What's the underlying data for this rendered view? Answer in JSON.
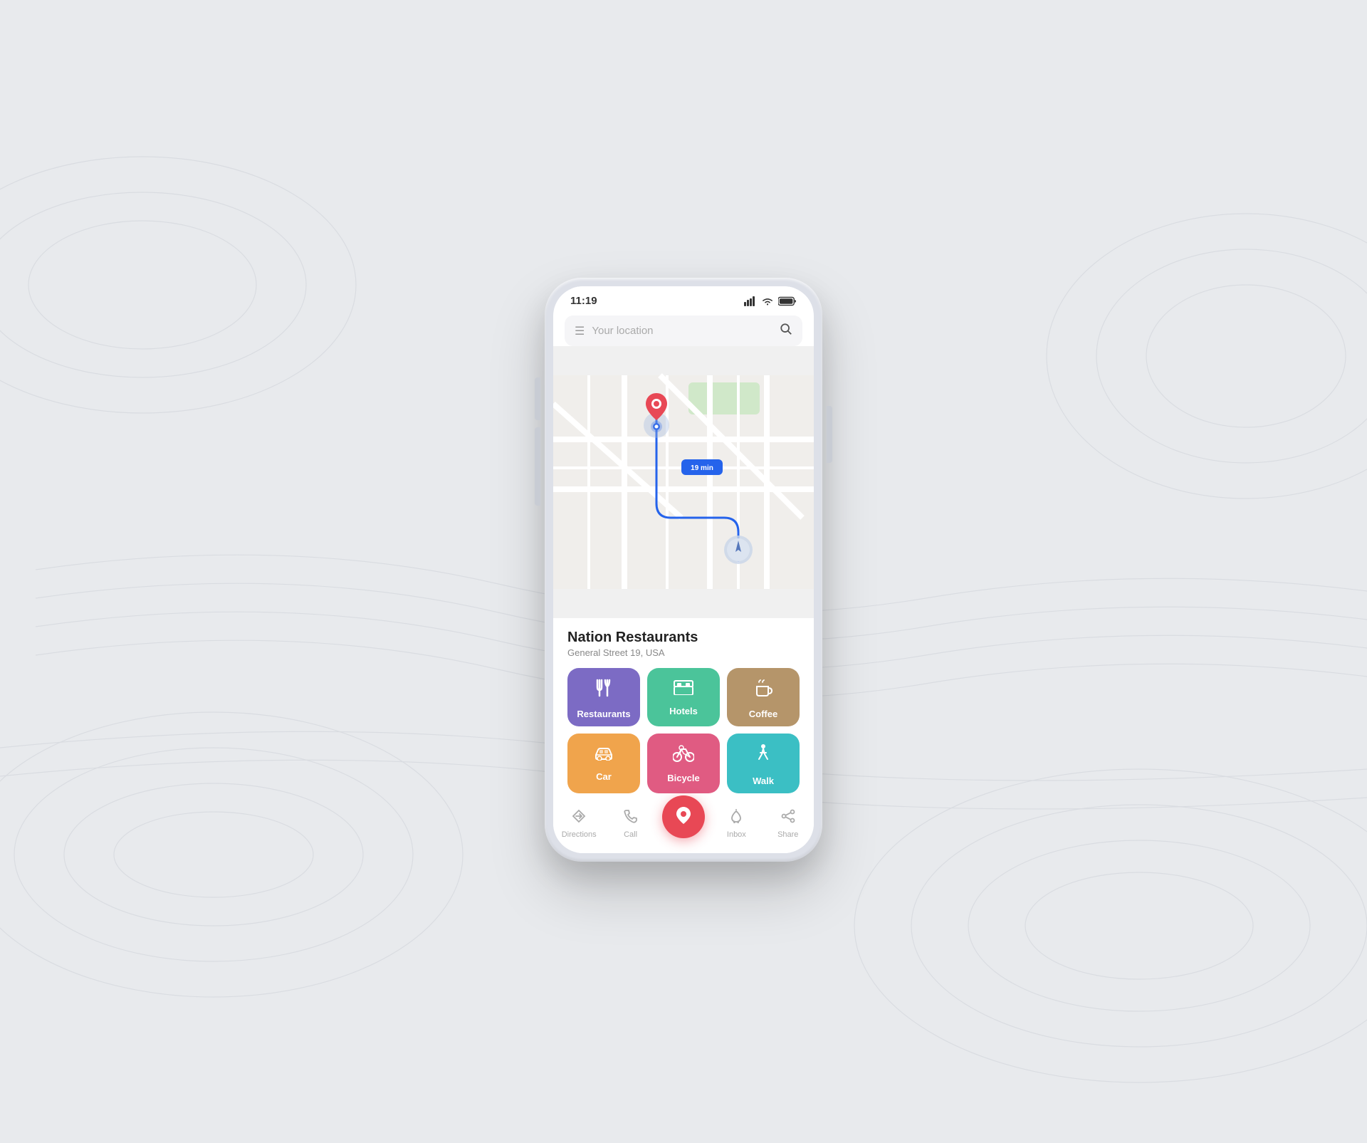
{
  "phone": {
    "status": {
      "time": "11:19",
      "signal_bars": 4,
      "wifi": true,
      "battery": "full"
    },
    "search": {
      "placeholder": "Your location",
      "menu_icon": "☰",
      "search_icon": "🔍"
    },
    "map": {
      "time_badge": "19 min"
    },
    "location": {
      "name": "Nation Restaurants",
      "address": "General Street 19, USA"
    },
    "categories": [
      {
        "id": "restaurants",
        "label": "Restaurants",
        "icon": "🍽",
        "color_class": "cat-restaurants"
      },
      {
        "id": "hotels",
        "label": "Hotels",
        "icon": "🛏",
        "color_class": "cat-hotels"
      },
      {
        "id": "coffee",
        "label": "Coffee",
        "icon": "☕",
        "color_class": "cat-coffee"
      },
      {
        "id": "car",
        "label": "Car",
        "icon": "🚗",
        "color_class": "cat-car"
      },
      {
        "id": "bicycle",
        "label": "Bicycle",
        "icon": "🚲",
        "color_class": "cat-bicycle"
      },
      {
        "id": "walk",
        "label": "Walk",
        "icon": "🚶",
        "color_class": "cat-walk"
      }
    ],
    "nav": [
      {
        "id": "directions",
        "label": "Directions",
        "icon": "◇"
      },
      {
        "id": "call",
        "label": "Call",
        "icon": "📞"
      },
      {
        "id": "location",
        "label": "",
        "icon": "📍",
        "center": true
      },
      {
        "id": "inbox",
        "label": "Inbox",
        "icon": "🔔"
      },
      {
        "id": "share",
        "label": "Share",
        "icon": "↑"
      }
    ]
  }
}
